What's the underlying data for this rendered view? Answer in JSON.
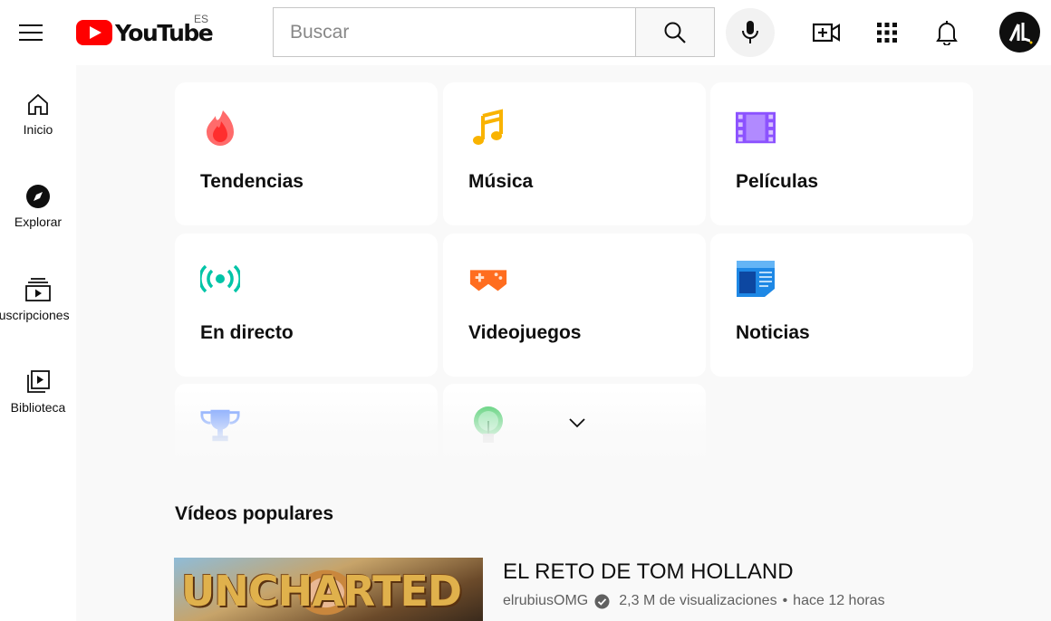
{
  "header": {
    "logo_text": "YouTube",
    "country_code": "ES",
    "search_placeholder": "Buscar",
    "brand_color": "#ff0000"
  },
  "sidebar": {
    "items": [
      {
        "label": "Inicio",
        "icon": "home-icon"
      },
      {
        "label": "Explorar",
        "icon": "explore-icon"
      },
      {
        "label": "Suscripciones",
        "icon": "subscriptions-icon"
      },
      {
        "label": "Biblioteca",
        "icon": "library-icon"
      }
    ]
  },
  "categories": [
    {
      "label": "Tendencias",
      "icon": "trending-flame-icon",
      "color": "#ff4e45"
    },
    {
      "label": "Música",
      "icon": "music-note-icon",
      "color": "#f9b300"
    },
    {
      "label": "Películas",
      "icon": "film-strip-icon",
      "color": "#8c52ff"
    },
    {
      "label": "En directo",
      "icon": "live-broadcast-icon",
      "color": "#00c4a7"
    },
    {
      "label": "Videojuegos",
      "icon": "gamepad-icon",
      "color": "#ff6d1f"
    },
    {
      "label": "Noticias",
      "icon": "newspaper-icon",
      "color": "#1e88e5"
    },
    {
      "label": "",
      "icon": "trophy-icon",
      "color": "#5c8dff"
    },
    {
      "label": "",
      "icon": "lightbulb-icon",
      "color": "#34c759"
    }
  ],
  "popular": {
    "section_title": "Vídeos populares",
    "video": {
      "thumbnail_text": "UNCHARTED",
      "title": "EL RETO DE TOM HOLLAND",
      "channel": "elrubiusOMG",
      "views": "2,3 M de visualizaciones",
      "separator": "•",
      "age": "hace 12 horas"
    }
  }
}
